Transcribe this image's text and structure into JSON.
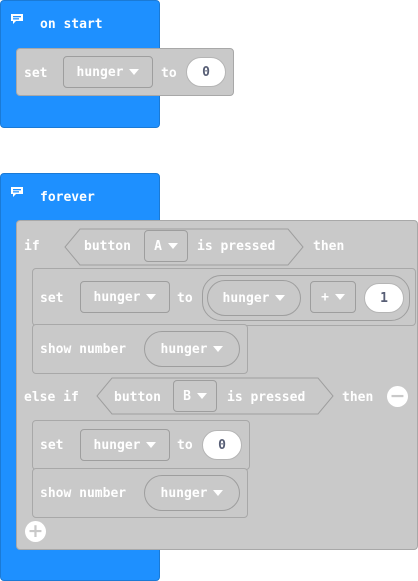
{
  "on_start": {
    "hat_label": "on start",
    "set_label": "set",
    "variable": "hunger",
    "to_label": "to",
    "value": "0"
  },
  "forever": {
    "hat_label": "forever",
    "if": {
      "if_label": "if",
      "button_label": "button",
      "button_value": "A",
      "pressed_label": "is pressed",
      "then_label": "then",
      "set_label": "set",
      "variable": "hunger",
      "to_label": "to",
      "op_variable": "hunger",
      "operator": "+",
      "op_value": "1",
      "show_label": "show number",
      "show_variable": "hunger"
    },
    "else_if": {
      "label": "else if",
      "button_label": "button",
      "button_value": "B",
      "pressed_label": "is pressed",
      "then_label": "then",
      "set_label": "set",
      "variable": "hunger",
      "to_label": "to",
      "value": "0",
      "show_label": "show number",
      "show_variable": "hunger"
    }
  },
  "icons": {
    "comment": "comment-icon",
    "caret": "chevron-down-icon",
    "remove": "minus-circle-icon",
    "add": "plus-circle-icon"
  },
  "colors": {
    "basic_blue": "#1e90ff",
    "variables_gray": "#c9c9c9"
  }
}
